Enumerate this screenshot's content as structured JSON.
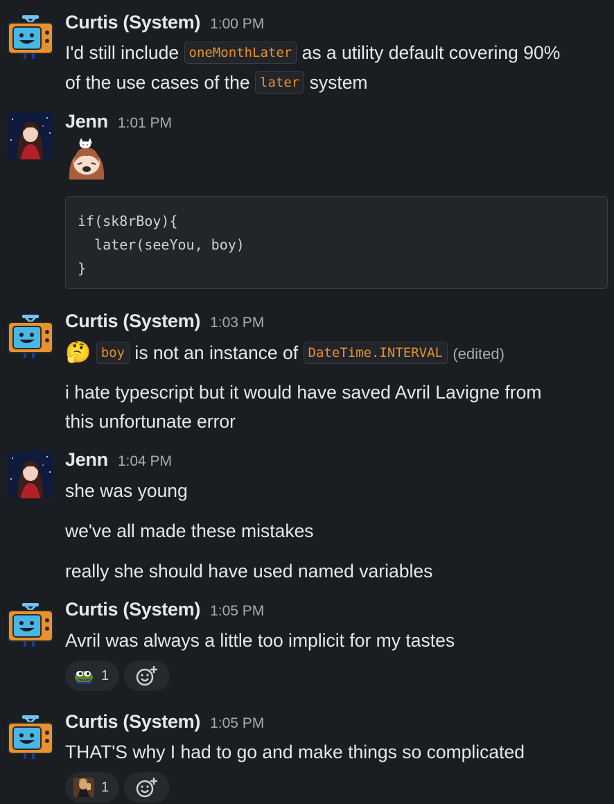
{
  "messages": [
    {
      "author": "Curtis (System)",
      "time": "1:00 PM",
      "line1_pre": "I'd still include ",
      "code1": "oneMonthLater",
      "line1_post": " as a utility default covering 90%",
      "line2_pre": "of the use cases of the ",
      "code2": "later",
      "line2_post": " system"
    },
    {
      "author": "Jenn",
      "time": "1:01 PM",
      "sticker": "anime-girl-sticker",
      "code_block": "if(sk8rBoy){\n  later(seeYou, boy)\n}"
    },
    {
      "author": "Curtis (System)",
      "time": "1:03 PM",
      "emoji": "🤔",
      "code1": "boy",
      "mid": " is not an instance of ",
      "code2": "DateTime.INTERVAL",
      "edited": "(edited)",
      "text2_line1": "i hate typescript but it would have saved Avril Lavigne from",
      "text2_line2": "this unfortunate error"
    },
    {
      "author": "Jenn",
      "time": "1:04 PM",
      "lines": [
        "she was young",
        "we've all made these mistakes",
        "really she should have used named variables"
      ]
    },
    {
      "author": "Curtis (System)",
      "time": "1:05 PM",
      "text": "Avril was always a little too implicit for my tastes",
      "reaction_icon": "pepe-frog-icon",
      "reaction_count": "1"
    },
    {
      "author": "Curtis (System)",
      "time": "1:05 PM",
      "text": "THAT'S why I had to go and make things so complicated",
      "reaction_icon": "leonardo-cheers-icon",
      "reaction_count": "1"
    }
  ],
  "colors": {
    "background": "#1a1d21",
    "inline_code": "#e8912d",
    "code_bg": "#222529"
  }
}
